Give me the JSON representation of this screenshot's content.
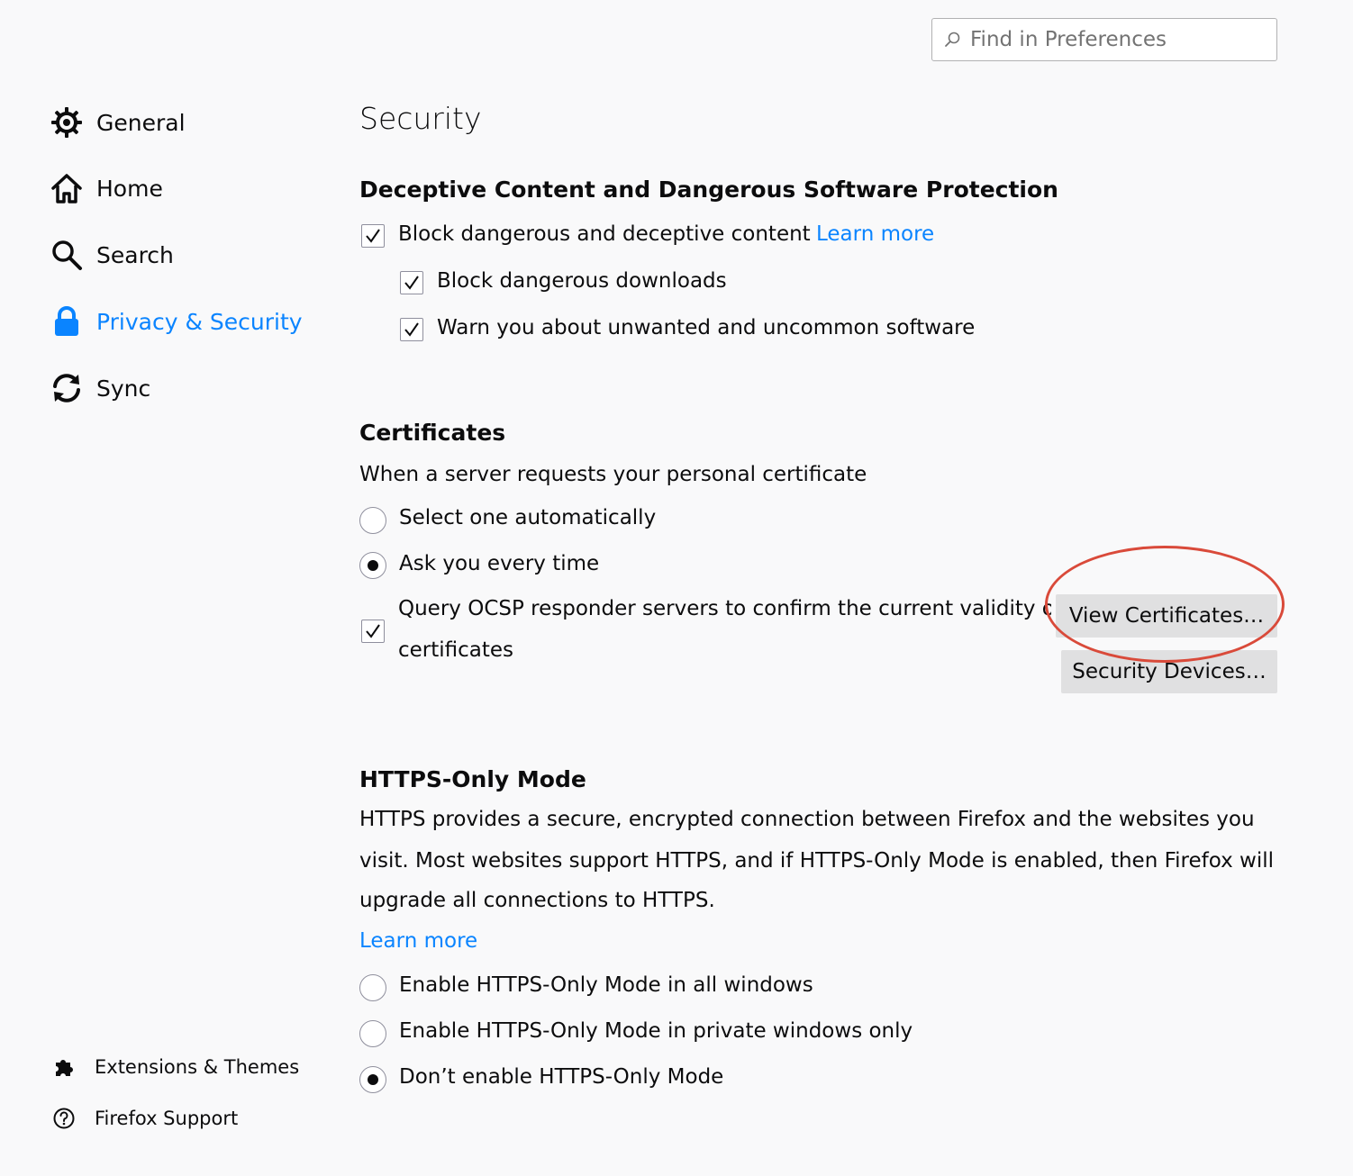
{
  "search": {
    "placeholder": "Find in Preferences",
    "icon": "search-icon"
  },
  "sidebar": {
    "items": [
      {
        "label": "General",
        "icon": "gear-icon",
        "selected": false
      },
      {
        "label": "Home",
        "icon": "home-icon",
        "selected": false
      },
      {
        "label": "Search",
        "icon": "magnifier-icon",
        "selected": false
      },
      {
        "label": "Privacy & Security",
        "icon": "lock-icon",
        "selected": true
      },
      {
        "label": "Sync",
        "icon": "sync-icon",
        "selected": false
      }
    ],
    "footer": [
      {
        "label": "Extensions & Themes",
        "icon": "puzzle-icon"
      },
      {
        "label": "Firefox Support",
        "icon": "help-icon"
      }
    ]
  },
  "colors": {
    "accent": "#0a84ff",
    "annotation": "#d94a3a",
    "background": "#f9f9fa"
  },
  "main": {
    "title": "Security",
    "deceptive": {
      "heading": "Deceptive Content and Dangerous Software Protection",
      "block_content": {
        "label": "Block dangerous and deceptive content",
        "checked": true
      },
      "learn_more": "Learn more",
      "block_downloads": {
        "label": "Block dangerous downloads",
        "checked": true
      },
      "warn_unwanted": {
        "label": "Warn you about unwanted and uncommon software",
        "checked": true
      }
    },
    "certificates": {
      "heading": "Certificates",
      "description": "When a server requests your personal certificate",
      "select_auto": {
        "label": "Select one automatically",
        "checked": false
      },
      "ask_every_time": {
        "label": "Ask you every time",
        "checked": true
      },
      "ocsp": {
        "line1": "Query OCSP responder servers to confirm the current validity of",
        "line2": "certificates",
        "checked": true
      },
      "view_certificates_button": "View Certificates…",
      "security_devices_button": "Security Devices…"
    },
    "https_only": {
      "heading": "HTTPS-Only Mode",
      "description_lines": [
        "HTTPS provides a secure, encrypted connection between Firefox and the websites you",
        "visit. Most websites support HTTPS, and if HTTPS-Only Mode is enabled, then Firefox will",
        "upgrade all connections to HTTPS."
      ],
      "learn_more": "Learn more",
      "options": [
        {
          "label": "Enable HTTPS-Only Mode in all windows",
          "checked": false
        },
        {
          "label": "Enable HTTPS-Only Mode in private windows only",
          "checked": false
        },
        {
          "label": "Don’t enable HTTPS-Only Mode",
          "checked": true
        }
      ]
    }
  }
}
